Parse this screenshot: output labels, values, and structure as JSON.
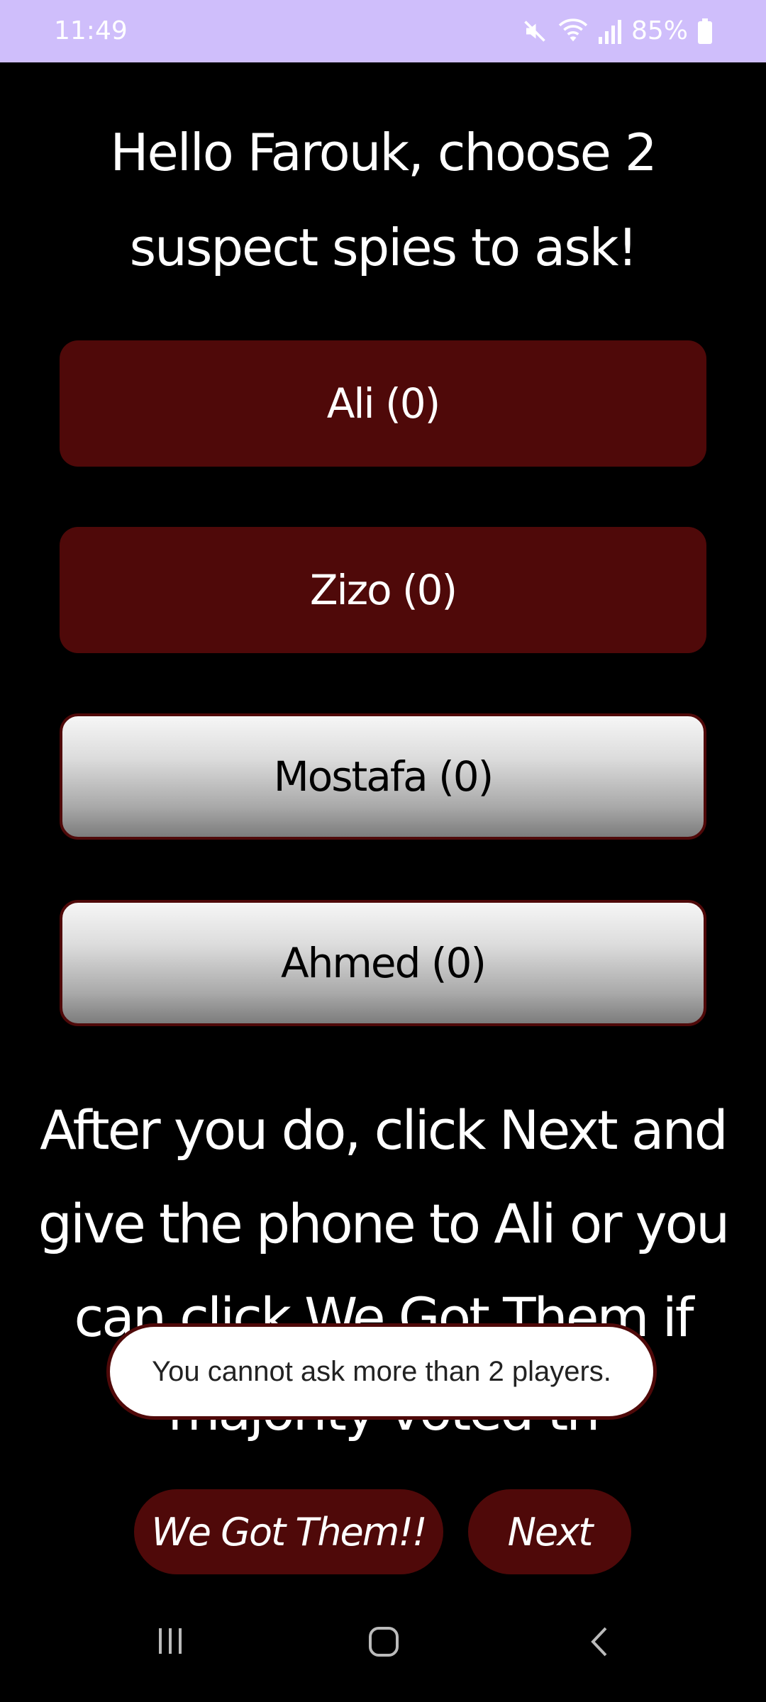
{
  "status_bar": {
    "time": "11:49",
    "battery_percent": "85%",
    "icons": [
      "mute-icon",
      "wifi-icon",
      "signal-icon",
      "battery-icon"
    ],
    "background": "#cfbefb"
  },
  "prompt": {
    "heading": "Hello Farouk, choose 2 suspect spies to ask!"
  },
  "players": [
    {
      "label": "Ali (0)",
      "selected": true
    },
    {
      "label": "Zizo (0)",
      "selected": true
    },
    {
      "label": "Mostafa (0)",
      "selected": false
    },
    {
      "label": "Ahmed (0)",
      "selected": false
    }
  ],
  "instructions": {
    "text": "After you do, click Next and give the phone to Ali or you can click We Got Them if majority voted th"
  },
  "toast": {
    "message": "You cannot ask more than 2 players."
  },
  "actions": {
    "we_got_them_label": "We Got Them!!",
    "next_label": "Next"
  },
  "nav_bar": {
    "icons": [
      "recent-apps-icon",
      "home-icon",
      "back-icon"
    ]
  },
  "colors": {
    "accent": "#4f0909",
    "background": "#000000",
    "text": "#ffffff"
  }
}
